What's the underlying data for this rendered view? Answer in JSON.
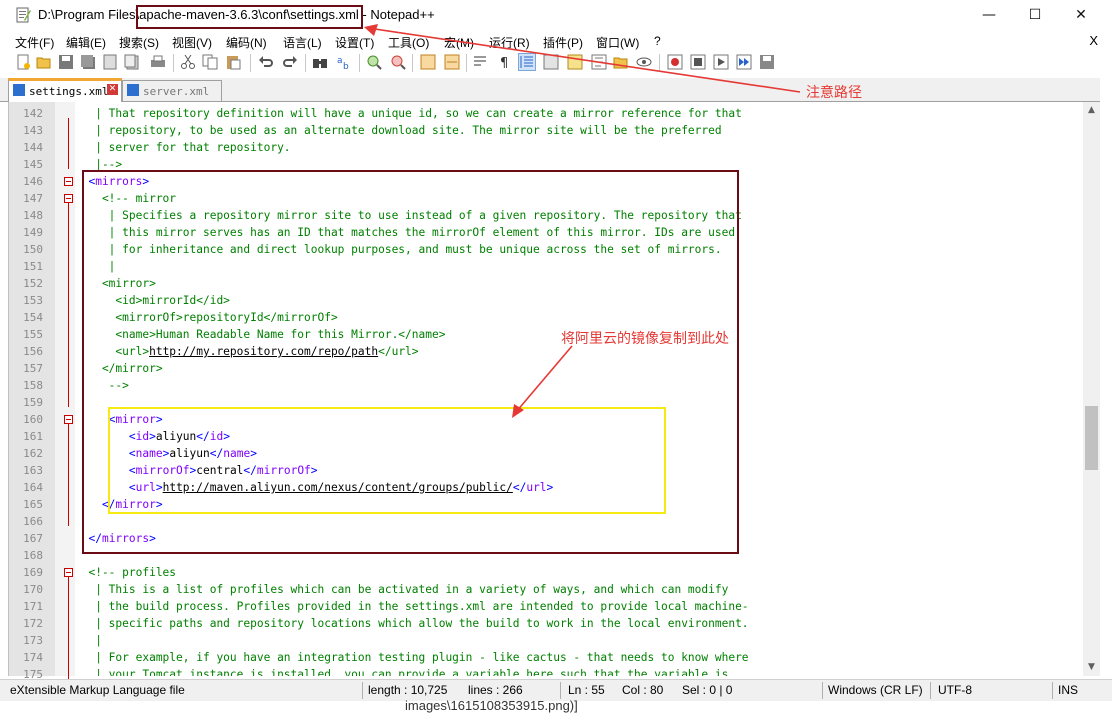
{
  "window": {
    "title_prefix": "D:\\Program Files\\",
    "title_highlight": "apache-maven-3.6.3\\conf\\settings.xml",
    "title_suffix": " - Notepad++",
    "minimize": "—",
    "maximize": "☐",
    "close": "✕"
  },
  "menu": [
    "文件(F)",
    "编辑(E)",
    "搜索(S)",
    "视图(V)",
    "编码(N)",
    "语言(L)",
    "设置(T)",
    "工具(O)",
    "宏(M)",
    "运行(R)",
    "插件(P)",
    "窗口(W)",
    "?"
  ],
  "menu_close": "X",
  "tabs": [
    {
      "label": "settings.xml",
      "active": true
    },
    {
      "label": "server.xml",
      "active": false
    }
  ],
  "annotations": {
    "path_note": "注意路径",
    "mirror_note": "将阿里云的镜像复制到此处"
  },
  "lines": [
    {
      "n": "142",
      "segs": [
        [
          "g",
          "   | That repository definition will have a unique id, so we can create a mirror reference for that"
        ]
      ]
    },
    {
      "n": "143",
      "segs": [
        [
          "g",
          "   | repository, to be used as an alternate download site. The mirror site will be the preferred"
        ]
      ]
    },
    {
      "n": "144",
      "segs": [
        [
          "g",
          "   | server for that repository."
        ]
      ]
    },
    {
      "n": "145",
      "segs": [
        [
          "g",
          "   |-->"
        ]
      ]
    },
    {
      "n": "146",
      "segs": [
        [
          "b",
          "  <"
        ],
        [
          "p",
          "mirrors"
        ],
        [
          "b",
          ">"
        ]
      ]
    },
    {
      "n": "147",
      "segs": [
        [
          "g",
          "    <!-- mirror"
        ]
      ]
    },
    {
      "n": "148",
      "segs": [
        [
          "g",
          "     | Specifies a repository mirror site to use instead of a given repository. The repository that"
        ]
      ]
    },
    {
      "n": "149",
      "segs": [
        [
          "g",
          "     | this mirror serves has an ID that matches the mirrorOf element of this mirror. IDs are used"
        ]
      ]
    },
    {
      "n": "150",
      "segs": [
        [
          "g",
          "     | for inheritance and direct lookup purposes, and must be unique across the set of mirrors."
        ]
      ]
    },
    {
      "n": "151",
      "segs": [
        [
          "g",
          "     |"
        ]
      ]
    },
    {
      "n": "152",
      "segs": [
        [
          "g",
          "    <mirror>"
        ]
      ]
    },
    {
      "n": "153",
      "segs": [
        [
          "g",
          "      <id>mirrorId</id>"
        ]
      ]
    },
    {
      "n": "154",
      "segs": [
        [
          "g",
          "      <mirrorOf>repositoryId</mirrorOf>"
        ]
      ]
    },
    {
      "n": "155",
      "segs": [
        [
          "g",
          "      <name>Human Readable Name for this Mirror.</name>"
        ]
      ]
    },
    {
      "n": "156",
      "segs": [
        [
          "g",
          "      <url>"
        ],
        [
          "gl",
          "http://my.repository.com/repo/path"
        ],
        [
          "g",
          "</url>"
        ]
      ]
    },
    {
      "n": "157",
      "segs": [
        [
          "g",
          "    </mirror>"
        ]
      ]
    },
    {
      "n": "158",
      "segs": [
        [
          "g",
          "     -->"
        ]
      ]
    },
    {
      "n": "159",
      "segs": [
        [
          "k",
          ""
        ]
      ]
    },
    {
      "n": "160",
      "segs": [
        [
          "b",
          "     <"
        ],
        [
          "p",
          "mirror"
        ],
        [
          "b",
          ">"
        ]
      ]
    },
    {
      "n": "161",
      "segs": [
        [
          "b",
          "        <"
        ],
        [
          "p",
          "id"
        ],
        [
          "b",
          ">"
        ],
        [
          "k",
          "aliyun"
        ],
        [
          "b",
          "</"
        ],
        [
          "p",
          "id"
        ],
        [
          "b",
          ">"
        ]
      ]
    },
    {
      "n": "162",
      "segs": [
        [
          "b",
          "        <"
        ],
        [
          "p",
          "name"
        ],
        [
          "b",
          ">"
        ],
        [
          "k",
          "aliyun"
        ],
        [
          "b",
          "</"
        ],
        [
          "p",
          "name"
        ],
        [
          "b",
          ">"
        ]
      ]
    },
    {
      "n": "163",
      "segs": [
        [
          "b",
          "        <"
        ],
        [
          "p",
          "mirrorOf"
        ],
        [
          "b",
          ">"
        ],
        [
          "k",
          "central"
        ],
        [
          "b",
          "</"
        ],
        [
          "p",
          "mirrorOf"
        ],
        [
          "b",
          ">"
        ]
      ]
    },
    {
      "n": "164",
      "segs": [
        [
          "b",
          "        <"
        ],
        [
          "p",
          "url"
        ],
        [
          "b",
          ">"
        ],
        [
          "kl",
          "http://maven.aliyun.com/nexus/content/groups/public/"
        ],
        [
          "b",
          "</"
        ],
        [
          "p",
          "url"
        ],
        [
          "b",
          ">"
        ]
      ]
    },
    {
      "n": "165",
      "segs": [
        [
          "b",
          "    </"
        ],
        [
          "p",
          "mirror"
        ],
        [
          "b",
          ">"
        ]
      ]
    },
    {
      "n": "166",
      "segs": [
        [
          "k",
          ""
        ]
      ]
    },
    {
      "n": "167",
      "segs": [
        [
          "b",
          "  </"
        ],
        [
          "p",
          "mirrors"
        ],
        [
          "b",
          ">"
        ]
      ]
    },
    {
      "n": "168",
      "segs": [
        [
          "k",
          ""
        ]
      ]
    },
    {
      "n": "169",
      "segs": [
        [
          "g",
          "  <!-- profiles"
        ]
      ]
    },
    {
      "n": "170",
      "segs": [
        [
          "g",
          "   | This is a list of profiles which can be activated in a variety of ways, and which can modify"
        ]
      ]
    },
    {
      "n": "171",
      "segs": [
        [
          "g",
          "   | the build process. Profiles provided in the settings.xml are intended to provide local machine-"
        ]
      ]
    },
    {
      "n": "172",
      "segs": [
        [
          "g",
          "   | specific paths and repository locations which allow the build to work in the local environment."
        ]
      ]
    },
    {
      "n": "173",
      "segs": [
        [
          "g",
          "   |"
        ]
      ]
    },
    {
      "n": "174",
      "segs": [
        [
          "g",
          "   | For example, if you have an integration testing plugin - like cactus - that needs to know where"
        ]
      ]
    },
    {
      "n": "175",
      "segs": [
        [
          "g",
          "   | your Tomcat instance is installed, you can provide a variable here such that the variable is"
        ]
      ]
    }
  ],
  "status": {
    "lang": "eXtensible Markup Language file",
    "length": "length : 10,725",
    "lines": "lines : 266",
    "ln": "Ln : 55",
    "col": "Col : 80",
    "sel": "Sel : 0 | 0",
    "eol": "Windows (CR LF)",
    "enc": "UTF-8",
    "ins": "INS"
  },
  "bottom_text": "images\\1615108353915.png)]"
}
